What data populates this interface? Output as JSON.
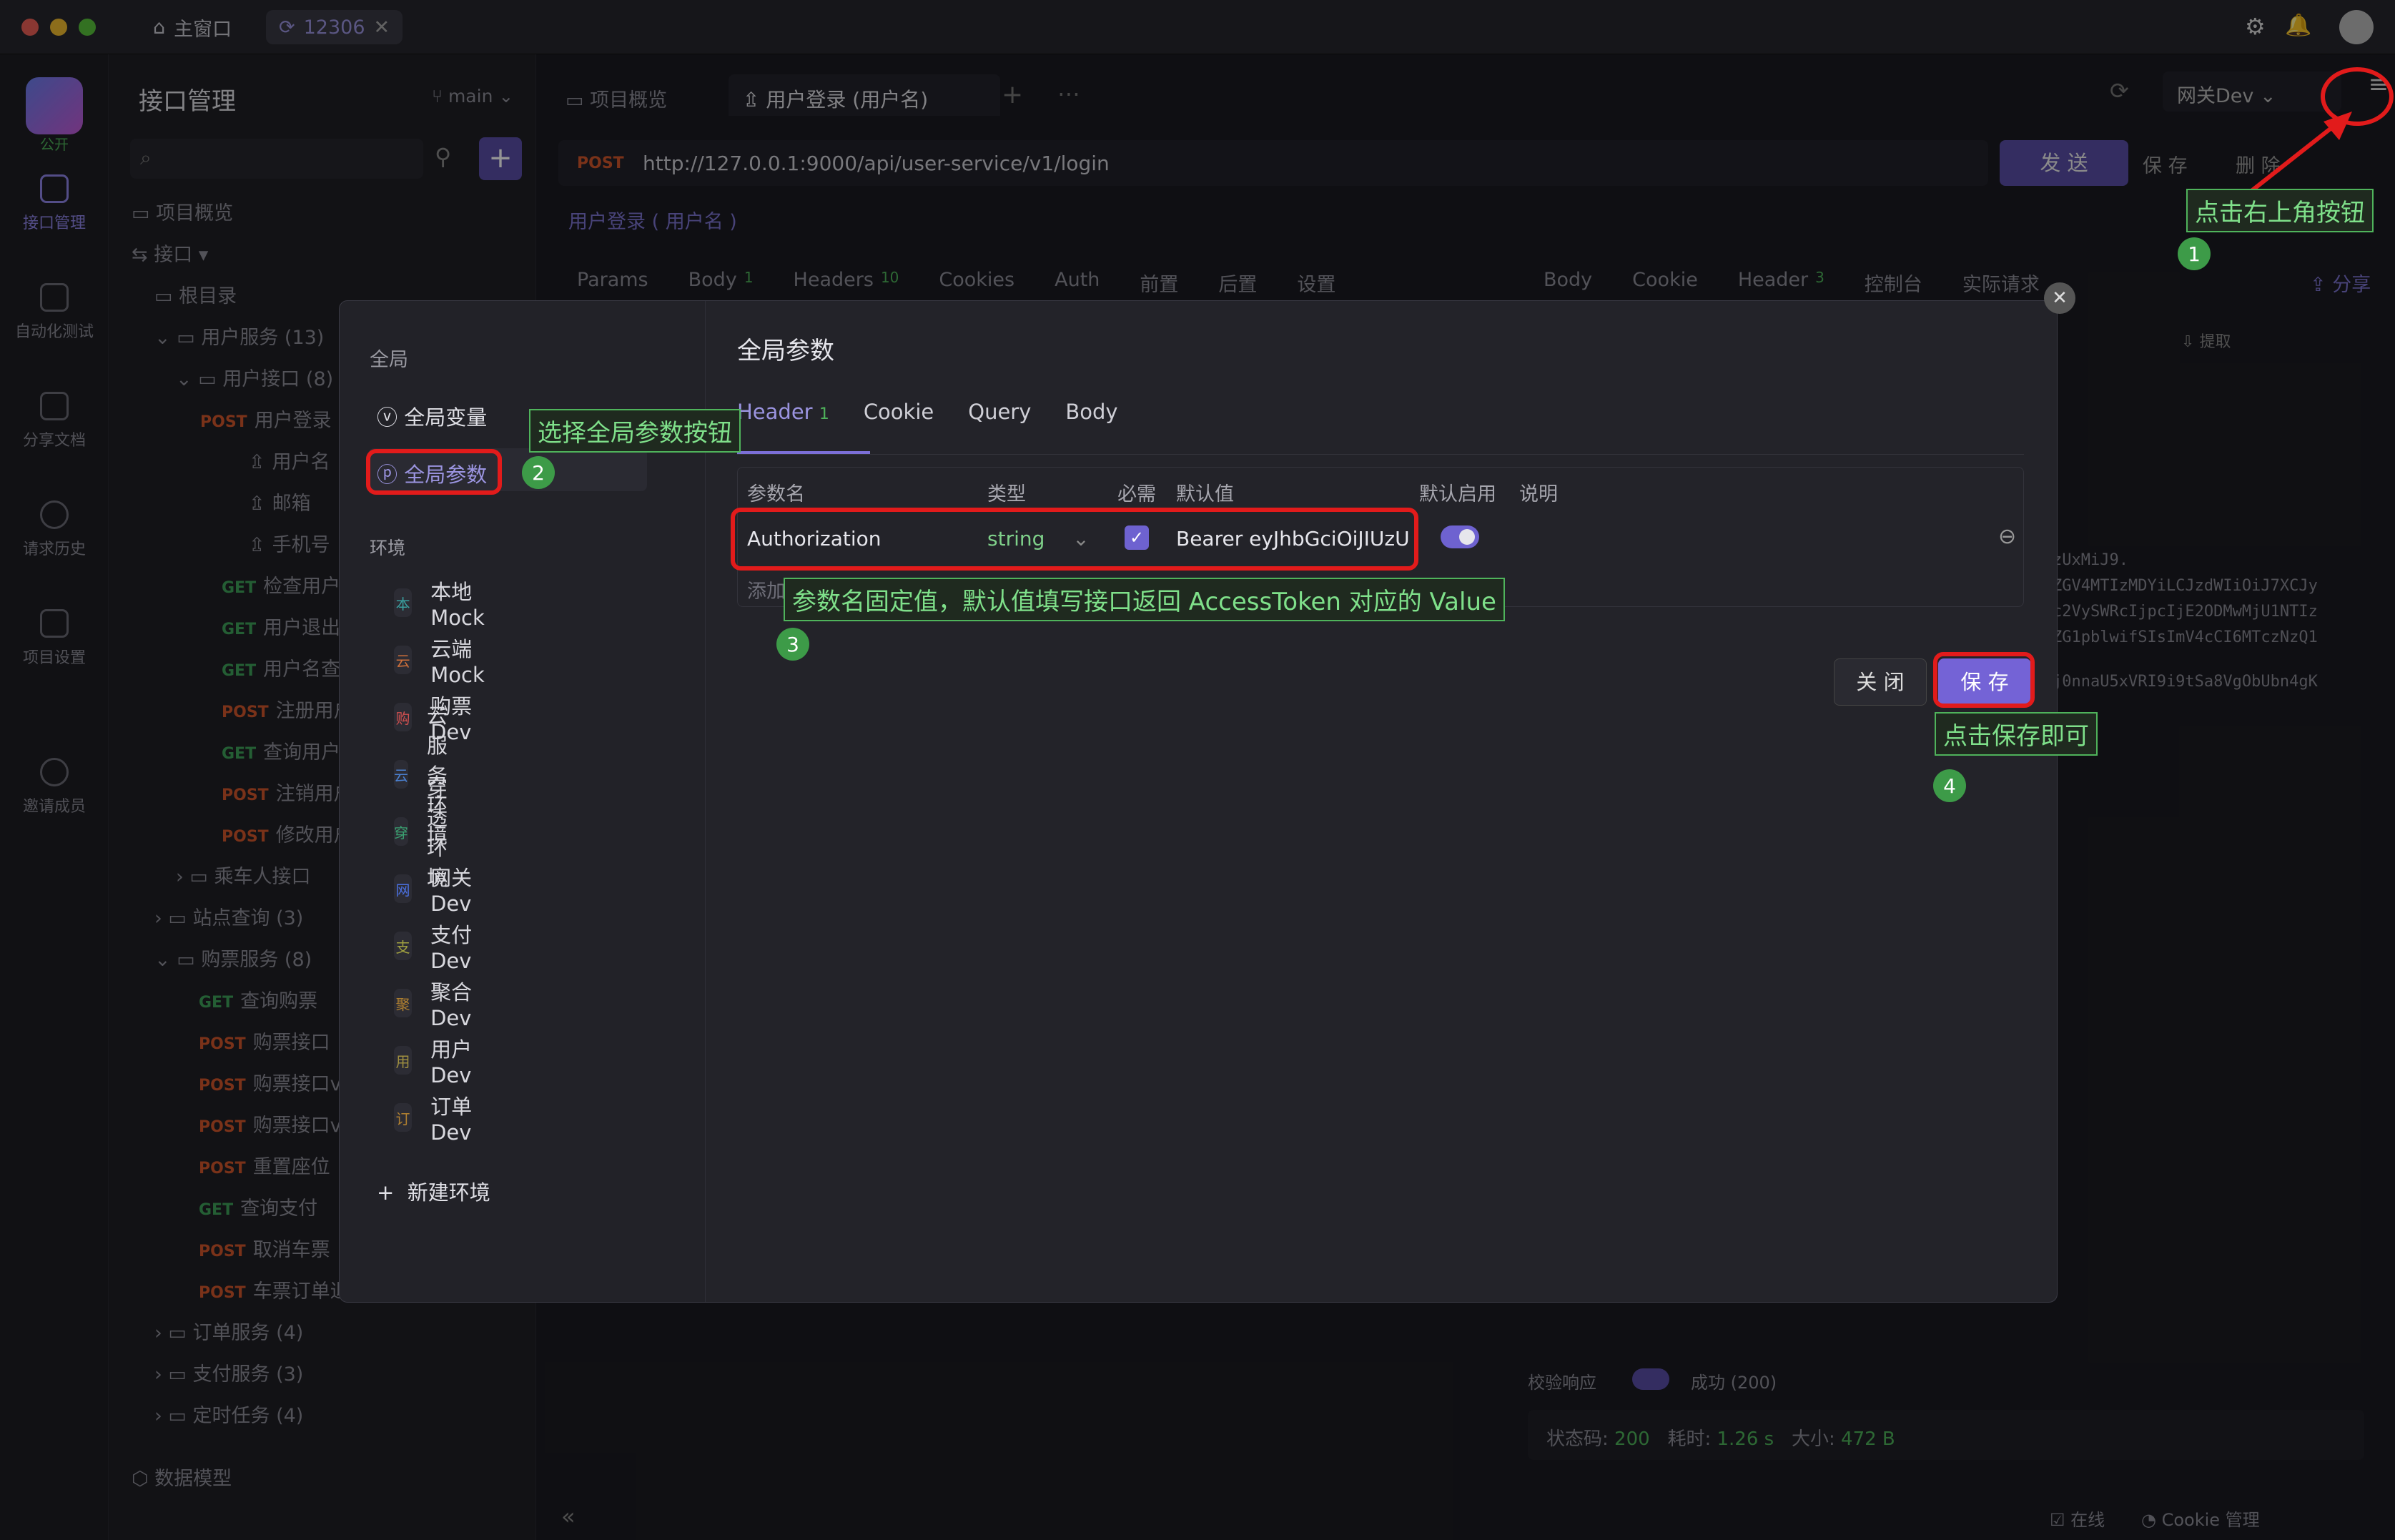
{
  "titlebar": {
    "home_tab": "主窗口",
    "project_tab": "12306"
  },
  "rail": [
    {
      "label": "公开",
      "icon": "app-logo-icon"
    },
    {
      "label": "接口管理",
      "icon": "api-icon"
    },
    {
      "label": "自动化测试",
      "icon": "automation-icon"
    },
    {
      "label": "分享文档",
      "icon": "share-doc-icon"
    },
    {
      "label": "请求历史",
      "icon": "history-icon"
    },
    {
      "label": "项目设置",
      "icon": "settings-icon"
    },
    {
      "label": "邀请成员",
      "icon": "invite-icon"
    }
  ],
  "sidebar": {
    "title": "接口管理",
    "branch": "main",
    "overview": "项目概览",
    "api_root": "接口",
    "root_dir": "根目录",
    "folders": {
      "user_service": "用户服务",
      "user_service_count": "(13)",
      "user_api": "用户接口",
      "user_api_count": "(8)",
      "passenger": "乘车人接口",
      "station": "站点查询",
      "station_count": "(3)",
      "ticket": "购票服务",
      "ticket_count": "(8)",
      "order": "订单服务",
      "order_count": "(4)",
      "pay": "支付服务",
      "pay_count": "(3)",
      "cron": "定时任务",
      "cron_count": "(4)"
    },
    "user_items": [
      {
        "method": "POST",
        "name": "用户登录"
      },
      {
        "method": "",
        "name": "用户名"
      },
      {
        "method": "",
        "name": "邮箱"
      },
      {
        "method": "",
        "name": "手机号"
      },
      {
        "method": "GET",
        "name": "检查用户"
      },
      {
        "method": "GET",
        "name": "用户退出"
      },
      {
        "method": "GET",
        "name": "用户名查"
      },
      {
        "method": "POST",
        "name": "注册用户"
      },
      {
        "method": "GET",
        "name": "查询用户"
      },
      {
        "method": "POST",
        "name": "注销用户"
      },
      {
        "method": "POST",
        "name": "修改用户"
      }
    ],
    "ticket_items": [
      {
        "method": "GET",
        "name": "查询购票"
      },
      {
        "method": "POST",
        "name": "购票接口"
      },
      {
        "method": "POST",
        "name": "购票接口v"
      },
      {
        "method": "POST",
        "name": "购票接口v"
      },
      {
        "method": "POST",
        "name": "重置座位"
      },
      {
        "method": "GET",
        "name": "查询支付"
      },
      {
        "method": "POST",
        "name": "取消车票"
      },
      {
        "method": "POST",
        "name": "车票订单退款"
      }
    ],
    "data_model": "数据模型"
  },
  "main": {
    "tab_overview": "项目概览",
    "tab_current": "用户登录 (用户名)",
    "env": "网关Dev",
    "method": "POST",
    "url": "http://127.0.0.1:9000/api/user-service/v1/login",
    "send": "发 送",
    "save": "保 存",
    "delete": "删 除",
    "breadcrumb": "用户登录 ( 用户名 )",
    "req_tabs": [
      "Params",
      "Body",
      "Headers",
      "Cookies",
      "Auth",
      "前置",
      "后置",
      "设置"
    ],
    "body_count": "1",
    "headers_count": "10",
    "resp_tabs": [
      "Body",
      "Cookie",
      "Header",
      "控制台",
      "实际请求"
    ],
    "resp_header_count": "3",
    "share": "分享",
    "extract": "提取",
    "resp_lines": [
      "zUxMiJ9.",
      "ZGV4MTIzMDYiLCJzdWIiOiJ7XCJy",
      "c2VySWRcIjpcIjE2ODMwMjU1NTIz",
      "ZG1pblwifSIsImV4cCI6MTczNzQ1",
      "j0nnaU5xVRI9i9tSa8VgObUbn4gK"
    ],
    "validate": "校验响应",
    "success": "成功 (200)",
    "status_label": "状态码:",
    "status": "200",
    "time_label": "耗时:",
    "time": "1.26 s",
    "size_label": "大小:",
    "size": "472 B",
    "footer_online": "在线",
    "footer_cookie": "Cookie 管理"
  },
  "modal": {
    "section_global": "全局",
    "global_vars": "全局变量",
    "global_params": "全局参数",
    "section_env": "环境",
    "environments": [
      {
        "badge": "本",
        "name": "本地 Mock",
        "color": "#3aa0a0"
      },
      {
        "badge": "云",
        "name": "云端 Mock",
        "color": "#d0703a"
      },
      {
        "badge": "购",
        "name": "购票Dev",
        "color": "#d05050"
      },
      {
        "badge": "云",
        "name": "云服务环境",
        "color": "#4a80d0"
      },
      {
        "badge": "穿",
        "name": "穿透环境",
        "color": "#3aa070"
      },
      {
        "badge": "网",
        "name": "网关Dev",
        "color": "#4a70e0"
      },
      {
        "badge": "支",
        "name": "支付Dev",
        "color": "#a0a040"
      },
      {
        "badge": "聚",
        "name": "聚合Dev",
        "color": "#b08030"
      },
      {
        "badge": "用",
        "name": "用户Dev",
        "color": "#a09040"
      },
      {
        "badge": "订",
        "name": "订单Dev",
        "color": "#b08030"
      }
    ],
    "new_env": "新建环境",
    "title": "全局参数",
    "tabs": [
      "Header",
      "Cookie",
      "Query",
      "Body"
    ],
    "header_count": "1",
    "columns": [
      "参数名",
      "类型",
      "必需",
      "默认值",
      "默认启用",
      "说明"
    ],
    "row": {
      "name": "Authorization",
      "type": "string",
      "default": "Bearer eyJhbGciOiJIUzU"
    },
    "add_param": "添加参数",
    "close": "关 闭",
    "save": "保 存"
  },
  "annotations": {
    "a1": "点击右上角按钮",
    "a2": "选择全局参数按钮",
    "a3": "参数名固定值，默认值填写接口返回 AccessToken 对应的 Value",
    "a4": "点击保存即可",
    "n1": "1",
    "n2": "2",
    "n3": "3",
    "n4": "4"
  },
  "colors": {
    "accent": "#7c6fd8",
    "annotation_green": "#4fb35b",
    "annotation_red": "#e21b1b"
  }
}
